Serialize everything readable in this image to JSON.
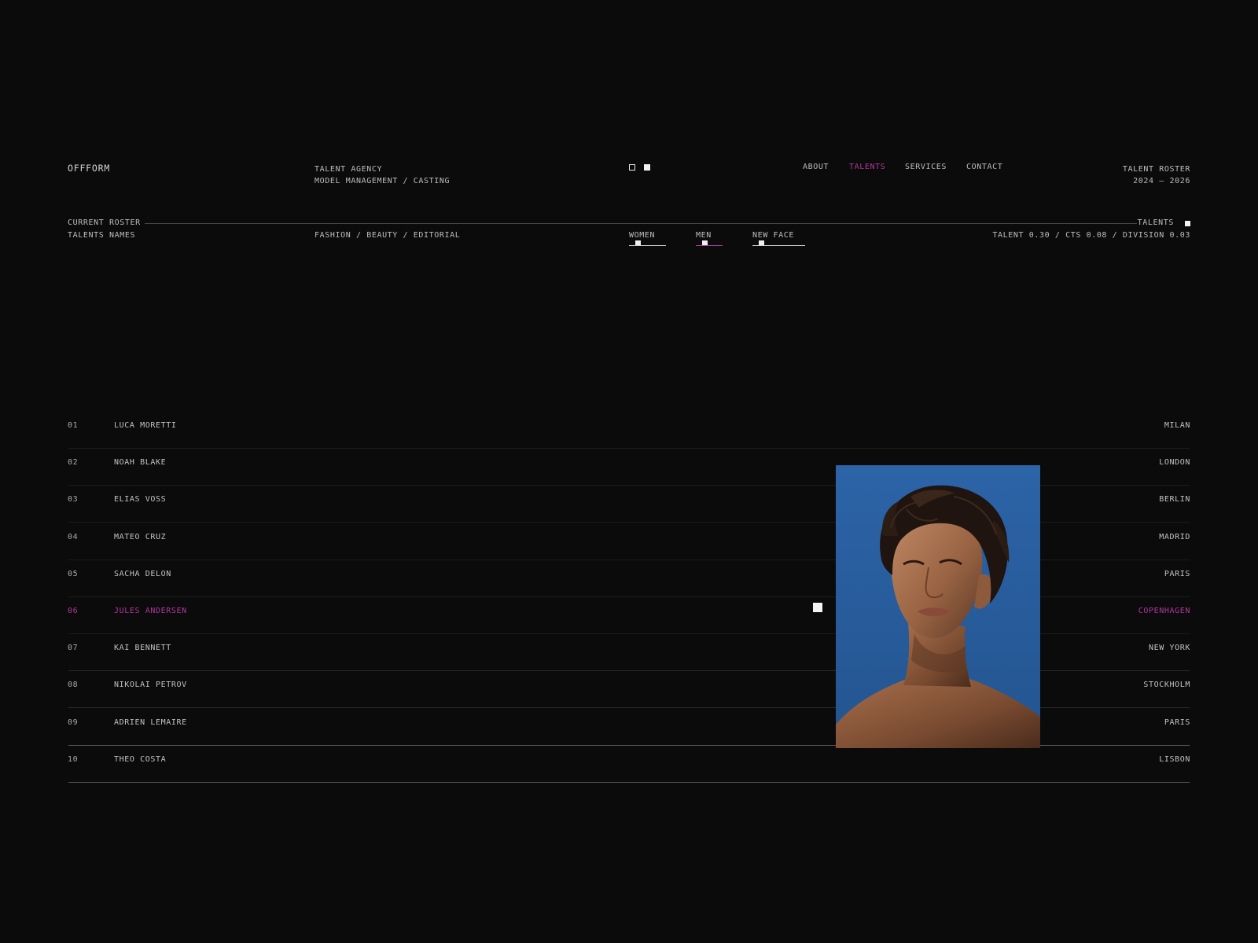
{
  "brand": {
    "logo": "OFFFORM"
  },
  "header": {
    "agency_line1": "TALENT AGENCY",
    "agency_line2": "MODEL MANAGEMENT / CASTING",
    "nav": [
      {
        "label": "ABOUT",
        "active": false
      },
      {
        "label": "TALENTS",
        "active": true
      },
      {
        "label": "SERVICES",
        "active": false
      },
      {
        "label": "CONTACT",
        "active": false
      }
    ],
    "roster_line1": "TALENT ROSTER",
    "roster_line2": "2024 — 2026"
  },
  "subbar": {
    "current": "CURRENT ROSTER",
    "names": "TALENTS NAMES",
    "talents_tag": "TALENTS",
    "categories": "FASHION / BEAUTY / EDITORIAL",
    "filters": [
      {
        "label": "WOMEN",
        "active": false
      },
      {
        "label": "MEN",
        "active": true
      },
      {
        "label": "NEW FACE",
        "active": false
      }
    ],
    "stats": "TALENT 0.30 / CTS 0.08 / DIVISION 0.03"
  },
  "talents": [
    {
      "num": "01",
      "name": "LUCA MORETTI",
      "city": "MILAN"
    },
    {
      "num": "02",
      "name": "NOAH BLAKE",
      "city": "LONDON"
    },
    {
      "num": "03",
      "name": "ELIAS VOSS",
      "city": "BERLIN"
    },
    {
      "num": "04",
      "name": "MATEO CRUZ",
      "city": "MADRID"
    },
    {
      "num": "05",
      "name": "SACHA DELON",
      "city": "PARIS"
    },
    {
      "num": "06",
      "name": "JULES ANDERSEN",
      "city": "COPENHAGEN"
    },
    {
      "num": "07",
      "name": "KAI BENNETT",
      "city": "NEW YORK"
    },
    {
      "num": "08",
      "name": "NIKOLAI PETROV",
      "city": "STOCKHOLM"
    },
    {
      "num": "09",
      "name": "ADRIEN LEMAIRE",
      "city": "PARIS"
    },
    {
      "num": "10",
      "name": "THEO COSTA",
      "city": "LISBON"
    }
  ],
  "selected_index": 5,
  "colors": {
    "background": "#0b0b0b",
    "accent": "#b0389b",
    "photo_bg": "#2a5fa0"
  }
}
